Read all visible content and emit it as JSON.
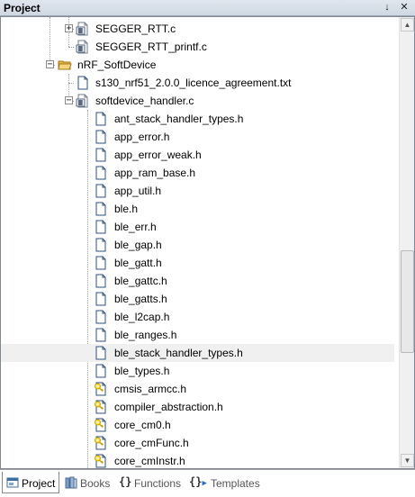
{
  "window": {
    "title": "Project",
    "pin_glyph": "↓",
    "close_glyph": "✕"
  },
  "tree": {
    "items": [
      {
        "label": "SEGGER_RTT.c",
        "icon": "c-file-icon",
        "expander": "+"
      },
      {
        "label": "SEGGER_RTT_printf.c",
        "icon": "c-file-icon",
        "expander": ""
      },
      {
        "label": "nRF_SoftDevice",
        "icon": "folder-open-icon",
        "expander": "−"
      },
      {
        "label": "s130_nrf51_2.0.0_licence_agreement.txt",
        "icon": "text-file-icon",
        "expander": ""
      },
      {
        "label": "softdevice_handler.c",
        "icon": "c-file-icon",
        "expander": "−"
      },
      {
        "label": "ant_stack_handler_types.h",
        "icon": "header-file-icon",
        "expander": ""
      },
      {
        "label": "app_error.h",
        "icon": "header-file-icon",
        "expander": ""
      },
      {
        "label": "app_error_weak.h",
        "icon": "header-file-icon",
        "expander": ""
      },
      {
        "label": "app_ram_base.h",
        "icon": "header-file-icon",
        "expander": ""
      },
      {
        "label": "app_util.h",
        "icon": "header-file-icon",
        "expander": ""
      },
      {
        "label": "ble.h",
        "icon": "header-file-icon",
        "expander": ""
      },
      {
        "label": "ble_err.h",
        "icon": "header-file-icon",
        "expander": ""
      },
      {
        "label": "ble_gap.h",
        "icon": "header-file-icon",
        "expander": ""
      },
      {
        "label": "ble_gatt.h",
        "icon": "header-file-icon",
        "expander": ""
      },
      {
        "label": "ble_gattc.h",
        "icon": "header-file-icon",
        "expander": ""
      },
      {
        "label": "ble_gatts.h",
        "icon": "header-file-icon",
        "expander": ""
      },
      {
        "label": "ble_l2cap.h",
        "icon": "header-file-icon",
        "expander": ""
      },
      {
        "label": "ble_ranges.h",
        "icon": "header-file-icon",
        "expander": ""
      },
      {
        "label": "ble_stack_handler_types.h",
        "icon": "header-file-icon",
        "expander": ""
      },
      {
        "label": "ble_types.h",
        "icon": "header-file-icon",
        "expander": ""
      },
      {
        "label": "cmsis_armcc.h",
        "icon": "header-key-icon",
        "expander": ""
      },
      {
        "label": "compiler_abstraction.h",
        "icon": "header-key-icon",
        "expander": ""
      },
      {
        "label": "core_cm0.h",
        "icon": "header-key-icon",
        "expander": ""
      },
      {
        "label": "core_cmFunc.h",
        "icon": "header-key-icon",
        "expander": ""
      },
      {
        "label": "core_cmInstr.h",
        "icon": "header-key-icon",
        "expander": ""
      }
    ]
  },
  "scrollbar": {
    "up_glyph": "▲",
    "down_glyph": "▼"
  },
  "tabs": [
    {
      "label": "Project",
      "icon": "project-icon",
      "active": true
    },
    {
      "label": "Books",
      "icon": "books-icon",
      "active": false
    },
    {
      "label": "Functions",
      "icon": "braces-icon",
      "active": false
    },
    {
      "label": "Templates",
      "icon": "templates-icon",
      "active": false
    }
  ],
  "colors": {
    "folder": "#e8b33c",
    "hover_row": "#f0f0f0",
    "key_icon": "#c9a400"
  }
}
